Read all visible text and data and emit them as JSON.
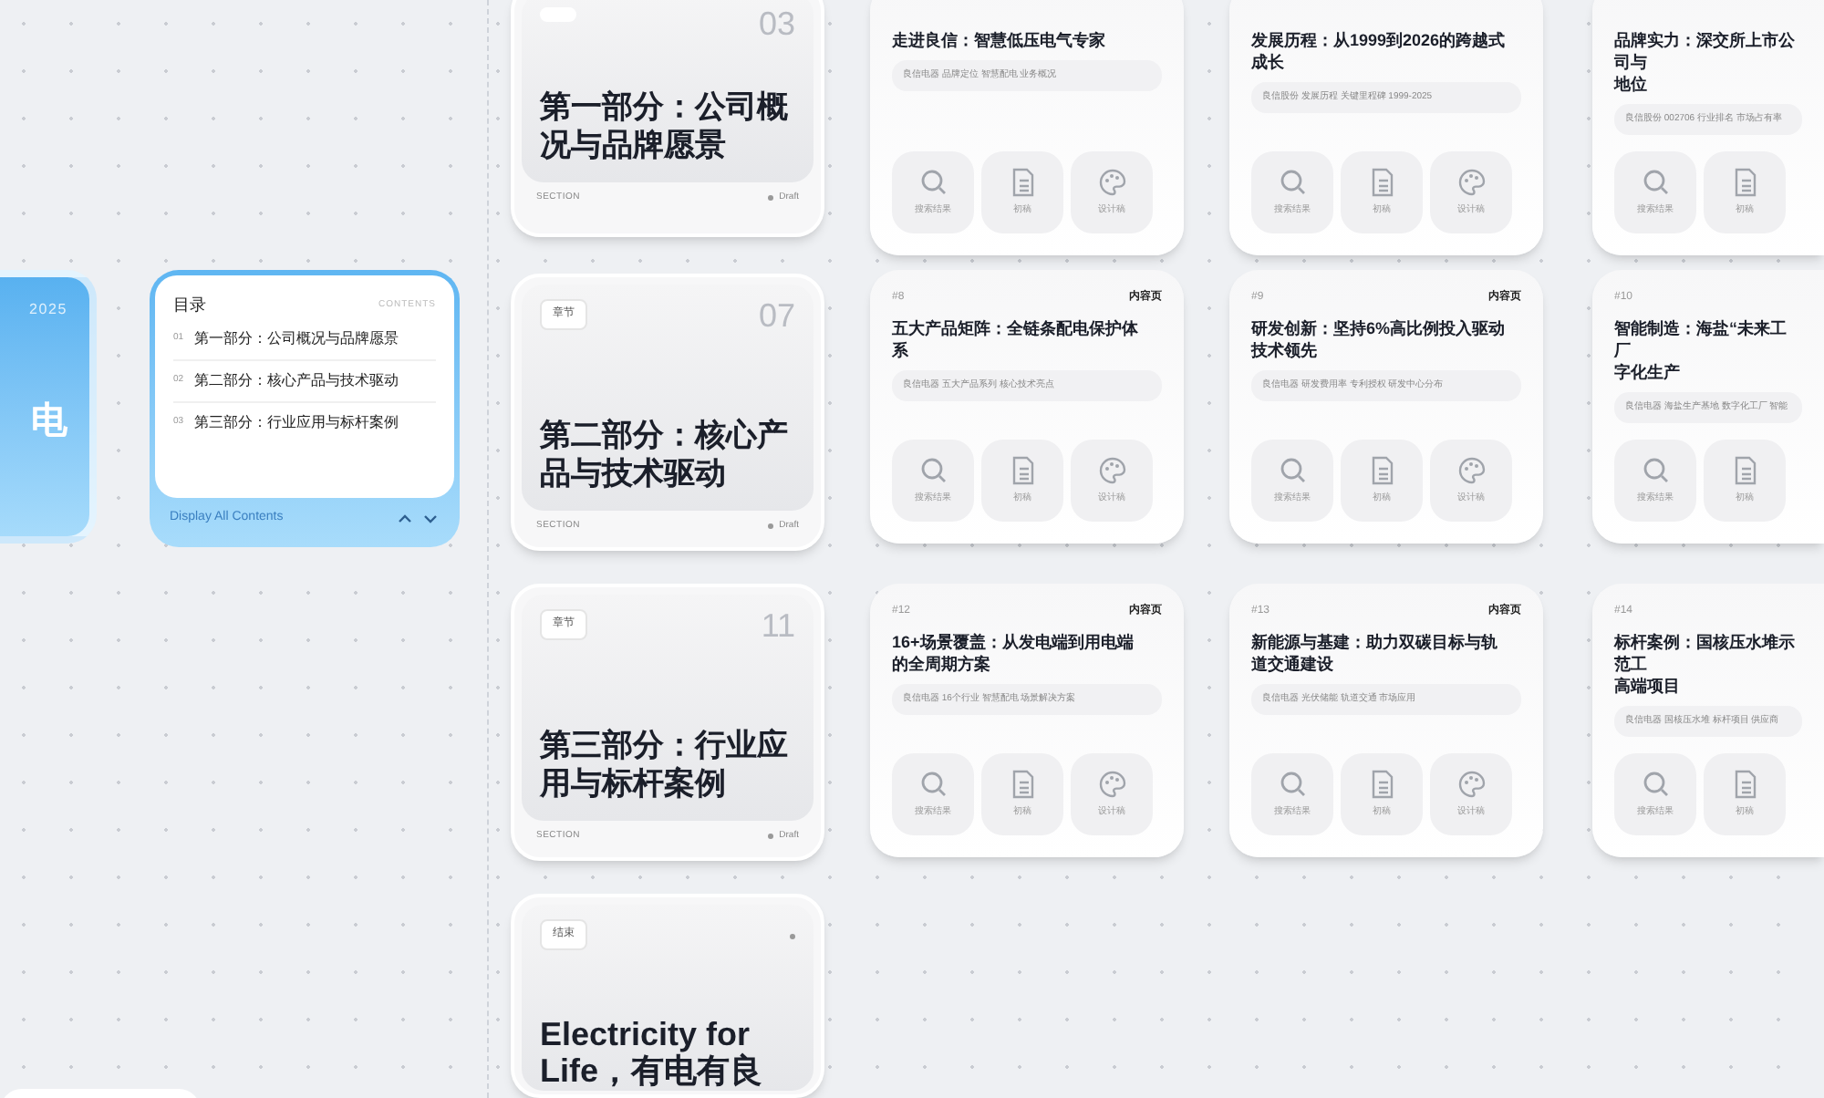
{
  "cover": {
    "year": "2025",
    "title": "电"
  },
  "contents": {
    "heading": "目录",
    "label": "CONTENTS",
    "items": [
      {
        "number": "01",
        "text": "第一部分：公司概况与品牌愿景"
      },
      {
        "number": "02",
        "text": "第二部分：核心产品与技术驱动"
      },
      {
        "number": "03",
        "text": "第三部分：行业应用与标杆案例"
      }
    ],
    "footer": "Display All Contents"
  },
  "sections": [
    {
      "number": "03",
      "title": "第一部分：公司概况与品牌愿景",
      "kind_label": "SECTION",
      "status": "Draft"
    },
    {
      "tag": "章节",
      "number": "07",
      "title": "第二部分：核心产品与技术驱动",
      "kind_label": "SECTION",
      "status": "Draft"
    },
    {
      "tag": "章节",
      "number": "11",
      "title": "第三部分：行业应用与标杆案例",
      "kind_label": "SECTION",
      "status": "Draft"
    }
  ],
  "ending": {
    "tag": "结束",
    "title": "Electricity for Life，有电有良"
  },
  "pages": [
    {
      "title": [
        "走进良信：智慧低压电气专家"
      ],
      "summary": "良信电器 品牌定位 智慧配电 业务概况",
      "actions": [
        "搜索结果",
        "初稿",
        "设计稿"
      ]
    },
    {
      "title": [
        "发展历程：从1999到2026的跨越式",
        "成长"
      ],
      "summary": "良信股份 发展历程 关键里程碑 1999-2025",
      "actions": [
        "搜索结果",
        "初稿",
        "设计稿"
      ]
    },
    {
      "title": [
        "品牌实力：深交所上市公司与",
        "地位"
      ],
      "summary": "良信股份 002706 行业排名 市场占有率",
      "actions": [
        "搜索结果",
        "初稿"
      ]
    },
    {
      "number": "#8",
      "type": "内容页",
      "title": [
        "五大产品矩阵：全链条配电保护体",
        "系"
      ],
      "summary": "良信电器 五大产品系列 核心技术亮点",
      "actions": [
        "搜索结果",
        "初稿",
        "设计稿"
      ]
    },
    {
      "number": "#9",
      "type": "内容页",
      "title": [
        "研发创新：坚持6%高比例投入驱动",
        "技术领先"
      ],
      "summary": "良信电器 研发费用率 专利授权 研发中心分布",
      "actions": [
        "搜索结果",
        "初稿",
        "设计稿"
      ]
    },
    {
      "number": "#10",
      "title": [
        "智能制造：海盐“未来工厂",
        "字化生产"
      ],
      "summary": "良信电器 海盐生产基地 数字化工厂 智能",
      "actions": [
        "搜索结果",
        "初稿"
      ]
    },
    {
      "number": "#12",
      "type": "内容页",
      "title": [
        "16+场景覆盖：从发电端到用电端",
        "的全周期方案"
      ],
      "summary": "良信电器 16个行业 智慧配电 场景解决方案",
      "actions": [
        "搜索结果",
        "初稿",
        "设计稿"
      ]
    },
    {
      "number": "#13",
      "type": "内容页",
      "title": [
        "新能源与基建：助力双碳目标与轨",
        "道交通建设"
      ],
      "summary": "良信电器 光伏储能 轨道交通 市场应用",
      "actions": [
        "搜索结果",
        "初稿",
        "设计稿"
      ]
    },
    {
      "number": "#14",
      "title": [
        "标杆案例：国核压水堆示范工",
        "高端项目"
      ],
      "summary": "良信电器 国核压水堆 标杆项目 供应商",
      "actions": [
        "搜索结果",
        "初稿"
      ]
    }
  ]
}
